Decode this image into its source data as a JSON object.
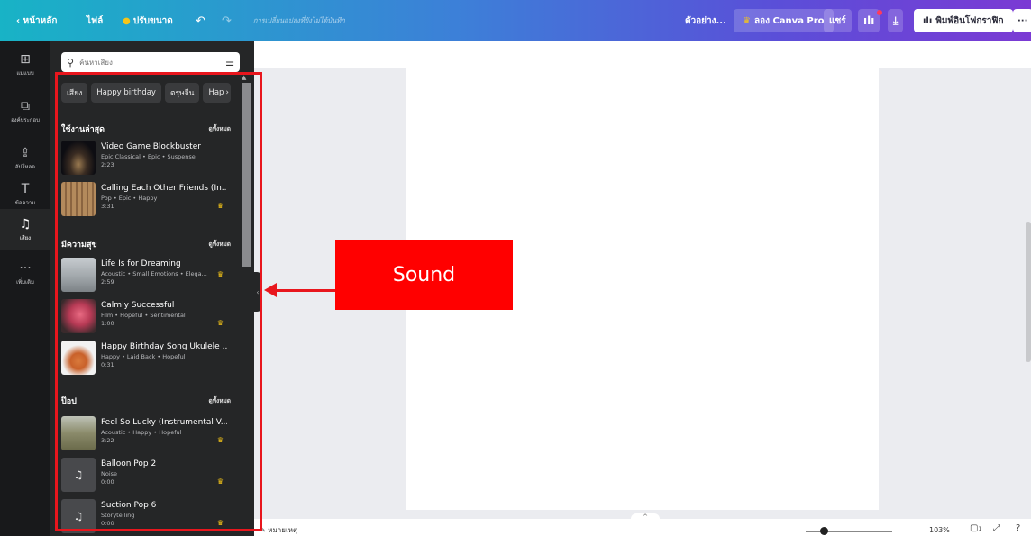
{
  "topbar": {
    "home": "หน้าหลัก",
    "file": "ไฟล์",
    "resize": "ปรับขนาด",
    "status": "การเปลี่ยนแปลงที่ยังไม่ได้บันทึก",
    "design_name": "ตัวอย่าง...",
    "pro": "ลอง Canva Pro",
    "share": "แชร์",
    "print": "พิมพ์อินโฟกราฟิก",
    "more": "···",
    "accent": "#7b3ad4"
  },
  "rail": [
    {
      "label": "แม่แบบ",
      "icon": "template-icon",
      "glyph": "⊞"
    },
    {
      "label": "องค์ประกอบ",
      "icon": "elements-icon",
      "glyph": "⧉"
    },
    {
      "label": "อัปโหลด",
      "icon": "upload-icon",
      "glyph": "⇪"
    },
    {
      "label": "ข้อความ",
      "icon": "text-icon",
      "glyph": "T"
    },
    {
      "label": "เสียง",
      "icon": "music-icon",
      "glyph": "♫"
    },
    {
      "label": "เพิ่มเติม",
      "icon": "more-icon",
      "glyph": "···"
    }
  ],
  "panel": {
    "search_placeholder": "ค้นหาเสียง",
    "chips": [
      "เสียง",
      "Happy birthday",
      "ตรุษจีน",
      "Hap"
    ],
    "see_all": "ดูทั้งหมด",
    "sections": [
      {
        "title": "ใช้งานล่าสุด",
        "tracks": [
          {
            "title": "Video Game Blockbuster",
            "tags": "Epic Classical • Epic • Suspense",
            "duration": "2:23",
            "pro": false
          },
          {
            "title": "Calling Each Other Friends (In...",
            "tags": "Pop • Epic • Happy",
            "duration": "3:31",
            "pro": true
          }
        ]
      },
      {
        "title": "มีความสุข",
        "tracks": [
          {
            "title": "Life Is for Dreaming",
            "tags": "Acoustic • Small Emotions • Elega...",
            "duration": "2:59",
            "pro": true
          },
          {
            "title": "Calmly Successful",
            "tags": "Film • Hopeful • Sentimental",
            "duration": "1:00",
            "pro": true
          },
          {
            "title": "Happy Birthday Song Ukulele ...",
            "tags": "Happy • Laid Back • Hopeful",
            "duration": "0:31",
            "pro": false
          }
        ]
      },
      {
        "title": "ป๊อป",
        "tracks": [
          {
            "title": "Feel So Lucky (Instrumental V...",
            "tags": "Acoustic • Happy • Hopeful",
            "duration": "3:22",
            "pro": true
          },
          {
            "title": "Balloon Pop 2",
            "tags": "Noise",
            "duration": "0:00",
            "pro": true
          },
          {
            "title": "Suction Pop 6",
            "tags": "Storytelling",
            "duration": "0:00",
            "pro": true
          }
        ]
      }
    ]
  },
  "bottom": {
    "notes": "หมายเหตุ",
    "zoom": "103%",
    "page_num": "1"
  },
  "annotation": {
    "label": "Sound",
    "color": "#ff0000"
  }
}
